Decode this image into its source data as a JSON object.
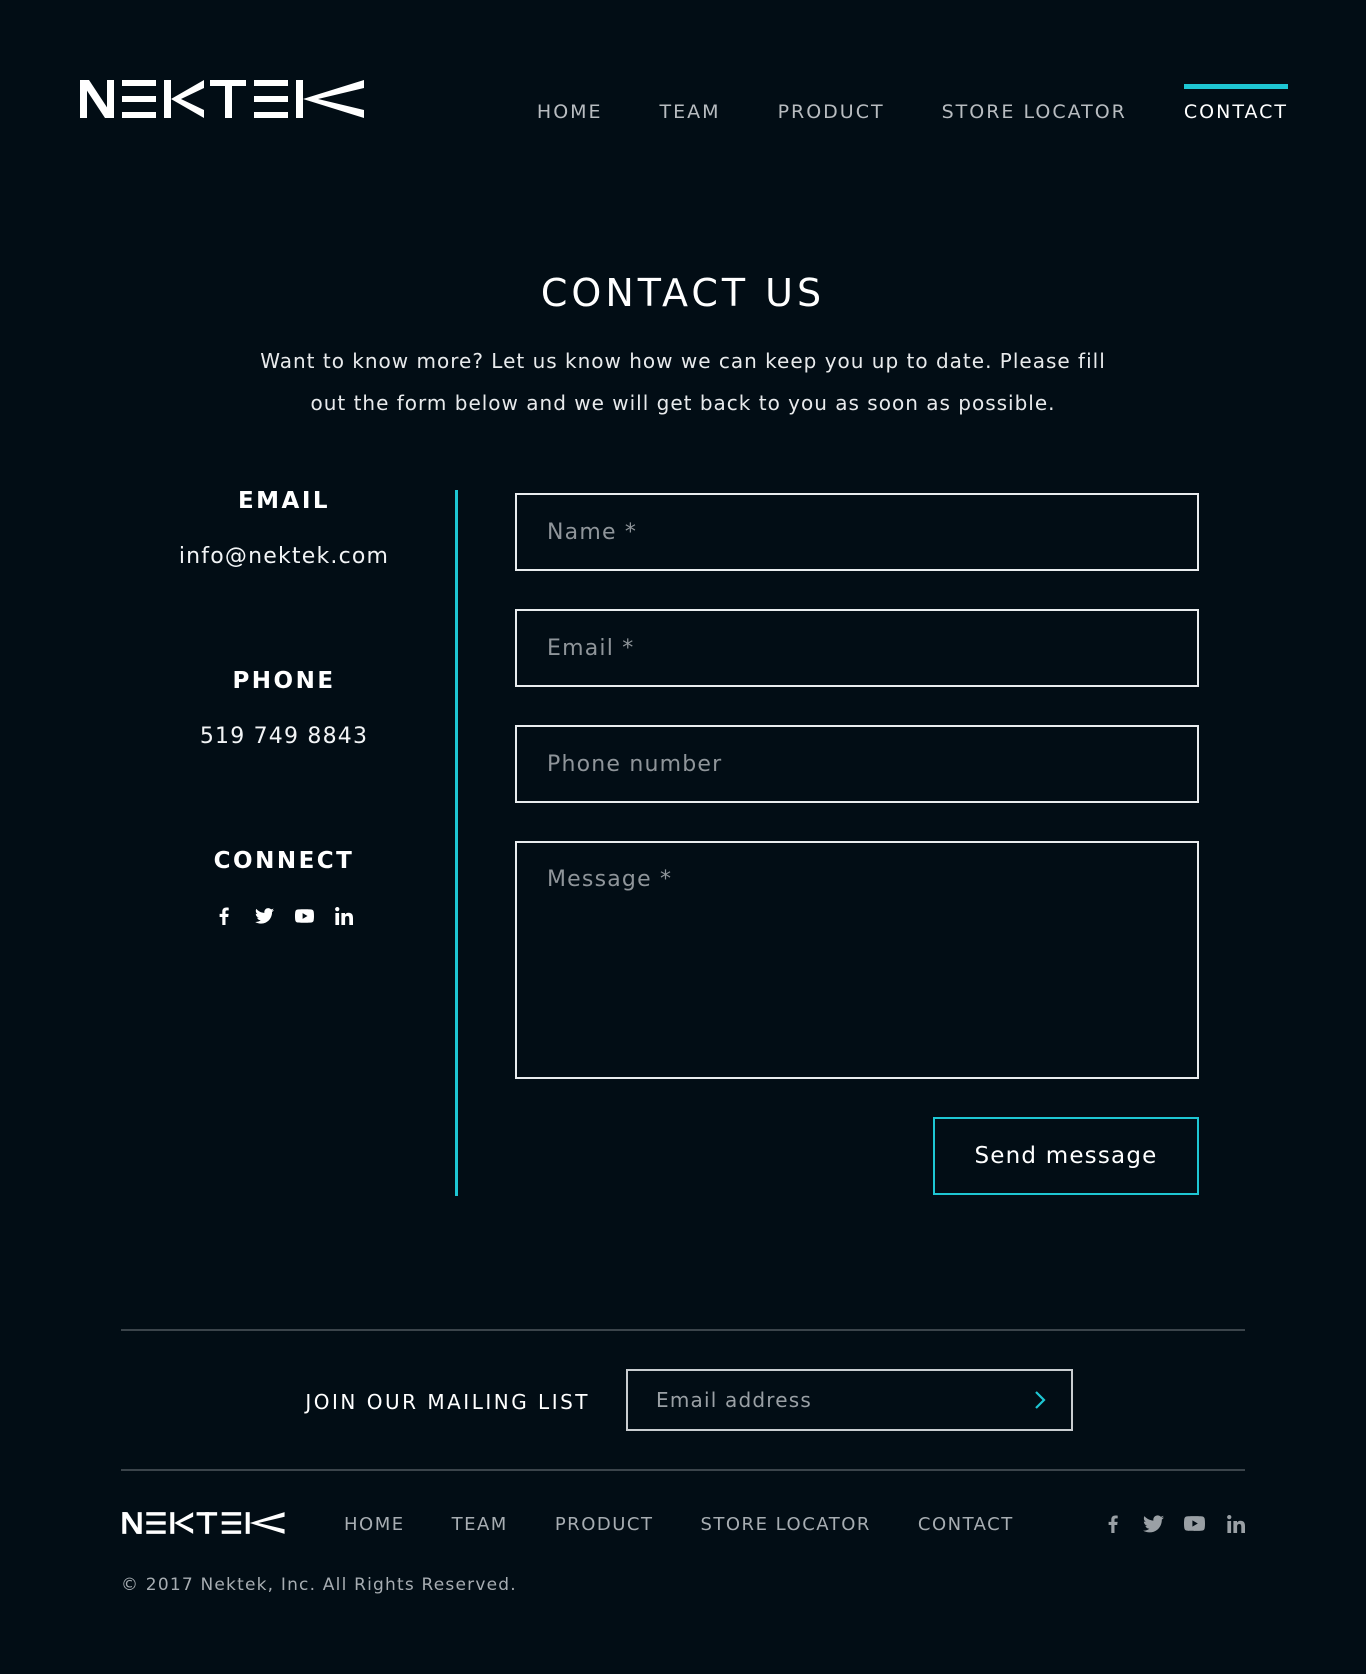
{
  "brand": {
    "logo_text": "NEKTEK",
    "accent_color": "#1ec6d3",
    "background_color": "#020d15"
  },
  "nav": {
    "items": [
      {
        "label": "HOME",
        "active": false
      },
      {
        "label": "TEAM",
        "active": false
      },
      {
        "label": "PRODUCT",
        "active": false
      },
      {
        "label": "STORE LOCATOR",
        "active": false
      },
      {
        "label": "CONTACT",
        "active": true
      }
    ]
  },
  "hero": {
    "title": "CONTACT US",
    "intro_line1": "Want to know more? Let us know how we can keep you up to date. Please fill",
    "intro_line2": "out the form below and we will get back to you as soon as possible."
  },
  "info": {
    "email_heading": "EMAIL",
    "email_value": "info@nektek.com",
    "phone_heading": "PHONE",
    "phone_value": "519 749 8843",
    "connect_heading": "CONNECT",
    "social_icons": [
      "facebook-icon",
      "twitter-icon",
      "youtube-icon",
      "linkedin-icon"
    ]
  },
  "form": {
    "name_placeholder": "Name *",
    "email_placeholder": "Email *",
    "phone_placeholder": "Phone number",
    "message_placeholder": "Message *",
    "send_label": "Send message"
  },
  "mailing": {
    "label": "JOIN OUR MAILING LIST",
    "placeholder": "Email address",
    "submit_icon": "chevron-right-icon"
  },
  "footer": {
    "nav": [
      "HOME",
      "TEAM",
      "PRODUCT",
      "STORE LOCATOR",
      "CONTACT"
    ],
    "social_icons": [
      "facebook-icon",
      "twitter-icon",
      "youtube-icon",
      "linkedin-icon"
    ],
    "copyright": "© 2017 Nektek, Inc. All Rights Reserved."
  }
}
